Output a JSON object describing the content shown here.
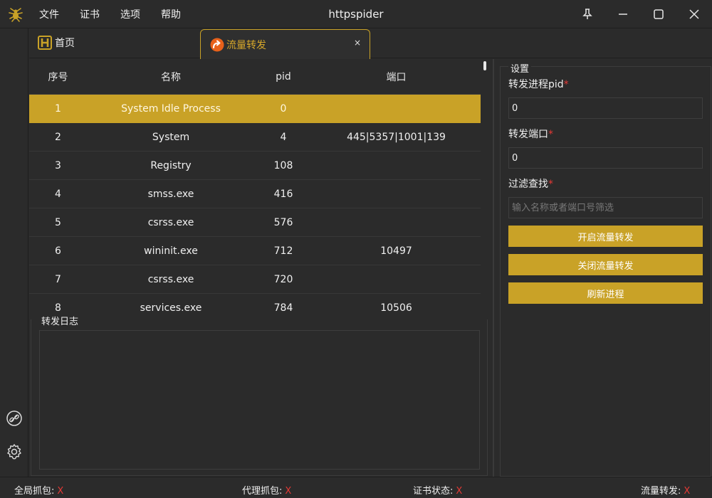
{
  "window": {
    "title": "httpspider",
    "menu": [
      "文件",
      "证书",
      "选项",
      "帮助"
    ]
  },
  "tabs": {
    "home_label": "首页",
    "active_label": "流量转发",
    "close_glyph": "×"
  },
  "process_table": {
    "headers": [
      "序号",
      "名称",
      "pid",
      "端口"
    ],
    "rows": [
      [
        "1",
        "System Idle Process",
        "0",
        ""
      ],
      [
        "2",
        "System",
        "4",
        "445|5357|1001|139"
      ],
      [
        "3",
        "Registry",
        "108",
        ""
      ],
      [
        "4",
        "smss.exe",
        "416",
        ""
      ],
      [
        "5",
        "csrss.exe",
        "576",
        ""
      ],
      [
        "6",
        "wininit.exe",
        "712",
        "10497"
      ],
      [
        "7",
        "csrss.exe",
        "720",
        ""
      ],
      [
        "8",
        "services.exe",
        "784",
        "10506"
      ]
    ],
    "selected_index": 0
  },
  "log": {
    "title": "转发日志",
    "content": ""
  },
  "settings": {
    "title": "设置",
    "pid_label": "转发进程pid",
    "pid_value": "0",
    "port_label": "转发端口",
    "port_value": "0",
    "filter_label": "过滤查找",
    "filter_placeholder": "输入名称或者端口号筛选",
    "required_mark": "*",
    "start_button": "开启流量转发",
    "stop_button": "关闭流量转发",
    "refresh_button": "刷新进程"
  },
  "status_bar": {
    "global_capture": "全局抓包:",
    "proxy_capture": "代理抓包:",
    "cert_status": "证书状态:",
    "traffic_forward": "流量转发:",
    "state_glyph": "X"
  },
  "colors": {
    "accent": "#c9a227",
    "error": "#e53935",
    "background": "#2b2b2b"
  },
  "icons": [
    "spider-logo-icon",
    "pin-icon",
    "minimize-icon",
    "maximize-icon",
    "close-icon",
    "home-h-icon",
    "forward-arrow-icon",
    "link-icon",
    "gear-icon"
  ]
}
